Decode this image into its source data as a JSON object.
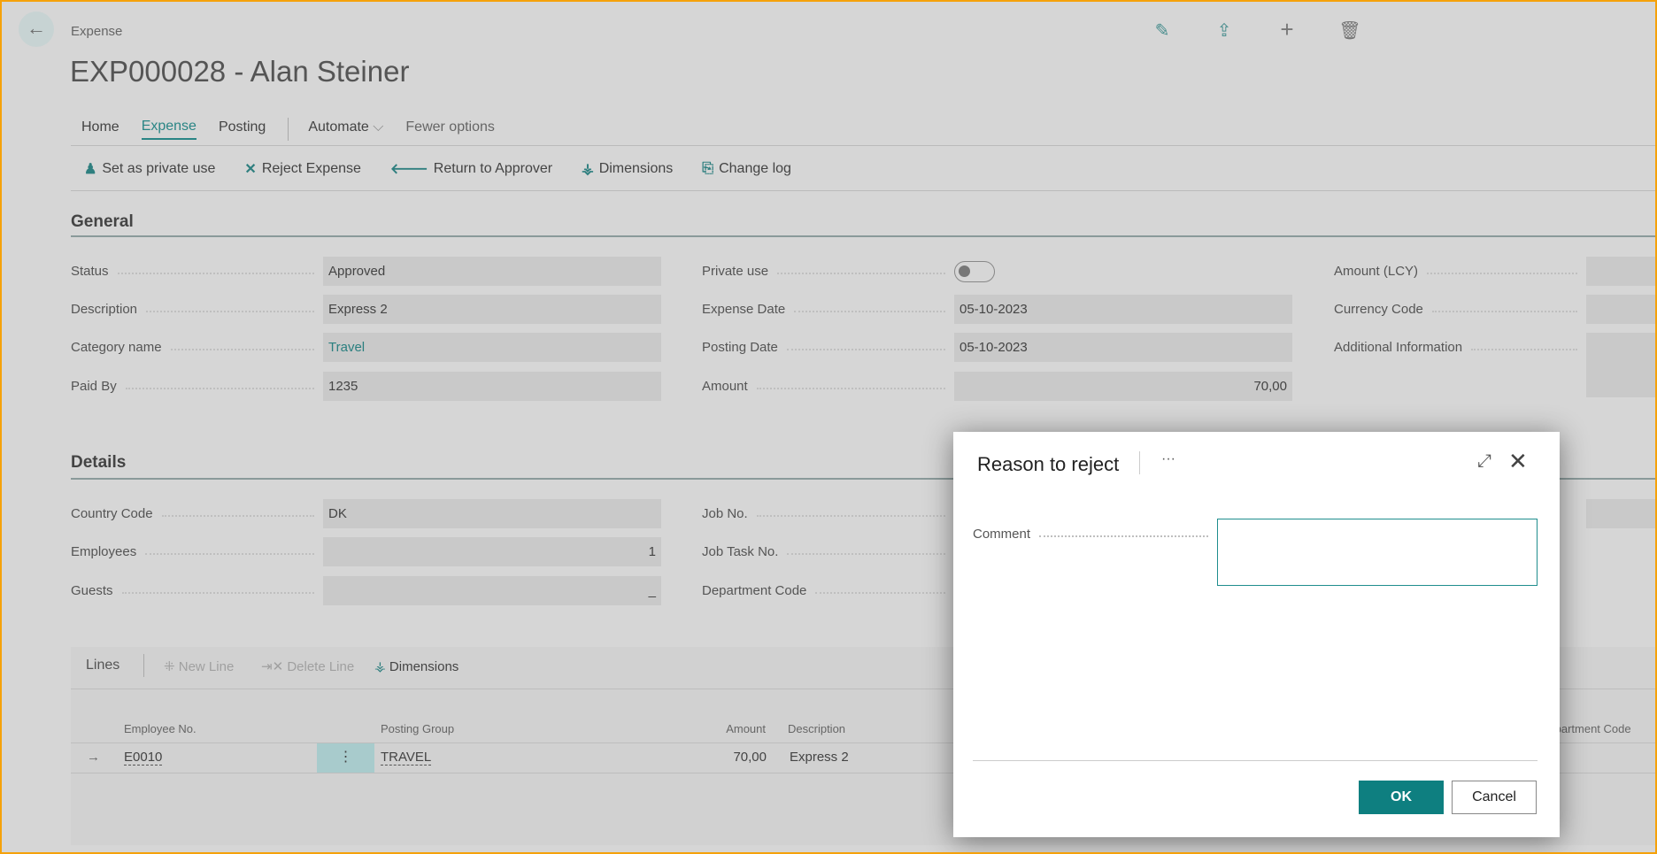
{
  "header": {
    "breadcrumb": "Expense",
    "title": "EXP000028 - Alan Steiner"
  },
  "tabs": [
    "Home",
    "Expense",
    "Posting",
    "Automate",
    "Fewer options"
  ],
  "actions": [
    "Set as private use",
    "Reject Expense",
    "Return to Approver",
    "Dimensions",
    "Change log"
  ],
  "general": {
    "heading": "General",
    "col1": [
      {
        "label": "Status",
        "value": "Approved"
      },
      {
        "label": "Description",
        "value": "Express 2"
      },
      {
        "label": "Category name",
        "value": "Travel"
      },
      {
        "label": "Paid By",
        "value": "1235"
      }
    ],
    "col2": [
      {
        "label": "Private use",
        "value": ""
      },
      {
        "label": "Expense Date",
        "value": "05-10-2023"
      },
      {
        "label": "Posting Date",
        "value": "05-10-2023"
      },
      {
        "label": "Amount",
        "value": "70,00"
      }
    ],
    "col3": [
      {
        "label": "Amount (LCY)"
      },
      {
        "label": "Currency Code"
      },
      {
        "label": "Additional Information"
      }
    ],
    "private_use": false
  },
  "details": {
    "heading": "Details",
    "col1": [
      {
        "label": "Country Code",
        "value": "DK"
      },
      {
        "label": "Employees",
        "value": "1"
      },
      {
        "label": "Guests",
        "value": "_"
      }
    ],
    "col2": [
      {
        "label": "Job No."
      },
      {
        "label": "Job Task No."
      },
      {
        "label": "Department Code"
      }
    ]
  },
  "lines": {
    "title": "Lines",
    "new_line": "New Line",
    "delete_line": "Delete Line",
    "dimensions": "Dimensions",
    "columns": [
      "Employee No.",
      "Posting Group",
      "Amount",
      "Description",
      "Department Code"
    ],
    "rows": [
      {
        "employee": "E0010",
        "posting_group": "TRAVEL",
        "amount": "70,00",
        "description": "Express 2"
      }
    ]
  },
  "dialog": {
    "title": "Reason to reject",
    "more": "···",
    "comment_label": "Comment",
    "comment_value": "",
    "ok": "OK",
    "cancel": "Cancel"
  },
  "colors": {
    "accent": "#0e7f80",
    "frame": "#f5a10a"
  }
}
